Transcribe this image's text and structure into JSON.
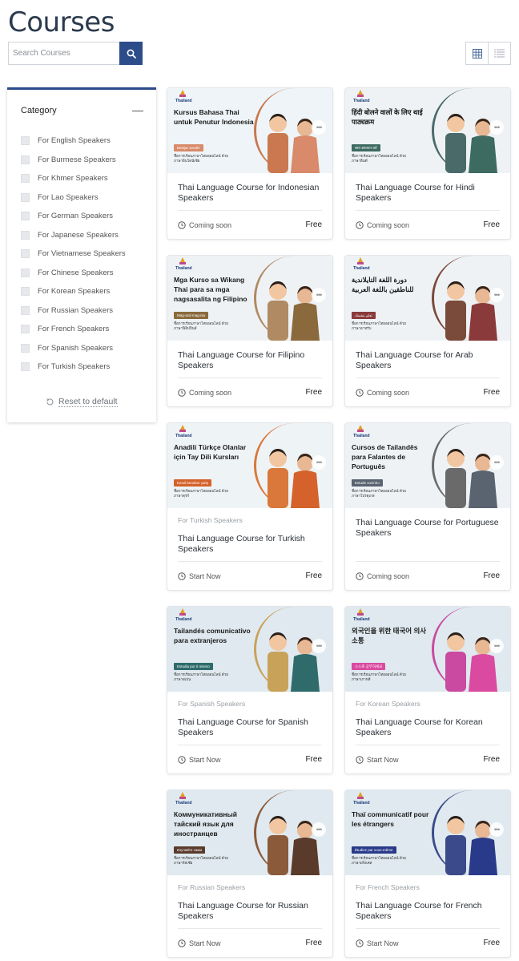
{
  "page": {
    "title": "Courses"
  },
  "search": {
    "placeholder": "Search Courses",
    "button_icon": "search-icon"
  },
  "view": {
    "grid_icon": "grid-view-icon",
    "list_icon": "list-view-icon"
  },
  "sidebar": {
    "heading": "Category",
    "items": [
      "For English Speakers",
      "For Burmese Speakers",
      "For Khmer Speakers",
      "For Lao Speakers",
      "For German Speakers",
      "For Japanese Speakers",
      "For Vietnamese Speakers",
      "For Chinese Speakers",
      "For Korean Speakers",
      "For Russian Speakers",
      "For French Speakers",
      "For Spanish Speakers",
      "For Turkish Speakers"
    ],
    "reset_label": "Reset to default"
  },
  "courses": [
    {
      "banner_title": "Kursus Bahasa Thai untuk Penutur Indonesia",
      "banner_tag": "Belajar sendiri",
      "banner_note": "ชื่อการเรียนภาษาไทยออนไลน์ ด้วยภาษาอินโดนีเซีย",
      "category": "",
      "title": "Thai Language Course for Indonesian Speakers",
      "status": "Coming soon",
      "price": "Free",
      "accent": "#c9784f",
      "tag_color": "#d98a6a",
      "bg": "#eef4f7"
    },
    {
      "banner_title": "हिंदी बोलने वालों के लिए थाई पाठ्यक्रम",
      "banner_tag": "स्वयं अध्ययन करें",
      "banner_note": "ชื่อการเรียนภาษาไทยออนไลน์ ด้วยภาษาฮินดี",
      "category": "",
      "title": "Thai Language Course for Hindi Speakers",
      "status": "Coming soon",
      "price": "Free",
      "accent": "#4a6a6a",
      "tag_color": "#3d6b62",
      "bg": "#eef2f4"
    },
    {
      "banner_title": "Mga Kurso sa Wikang Thai para sa mga nagsasalita ng Filipino",
      "banner_tag": "Mag-aral mag-isa",
      "banner_note": "ชื่อการเรียนภาษาไทยออนไลน์ ด้วยภาษาฟิลิปปินส์",
      "category": "",
      "title": "Thai Language Course for Filipino Speakers",
      "status": "Coming soon",
      "price": "Free",
      "accent": "#b08a62",
      "tag_color": "#8a6a3d",
      "bg": "#eef2f5"
    },
    {
      "banner_title": "دورة اللغة التايلاندية للناطقين باللغة العربية",
      "banner_tag": "تعلم بنفسك",
      "banner_note": "ชื่อการเรียนภาษาไทยออนไลน์ ด้วยภาษาอาหรับ",
      "category": "",
      "title": "Thai Language Course for Arab Speakers",
      "status": "Coming soon",
      "price": "Free",
      "accent": "#7a4a3a",
      "tag_color": "#8a3a3a",
      "bg": "#eef2f5"
    },
    {
      "banner_title": "Anadili Türkçe Olanlar için Tay Dili Kursları",
      "banner_tag": "Kendi kendine çalış",
      "banner_note": "ชื่อการเรียนภาษาไทยออนไลน์ ด้วยภาษาตุรกี",
      "category": "For Turkish Speakers",
      "title": "Thai Language Course for Turkish Speakers",
      "status": "Start Now",
      "price": "Free",
      "accent": "#d9783a",
      "tag_color": "#d4622a",
      "bg": "#eef3f6"
    },
    {
      "banner_title": "Cursos de Tailandês para Falantes de Português",
      "banner_tag": "Estude sozinho",
      "banner_note": "ชื่อการเรียนภาษาไทยออนไลน์ ด้วยภาษาโปรตุเกส",
      "category": "",
      "title": "Thai Language Course for Portuguese Speakers",
      "status": "Coming soon",
      "price": "Free",
      "accent": "#6a6a6a",
      "tag_color": "#5a6470",
      "bg": "#eef2f5"
    },
    {
      "banner_title": "Tailandés comunicativo para extranjeros",
      "banner_tag": "Estudia por ti mismo",
      "banner_note": "ชื่อการเรียนภาษาไทยออนไลน์ ด้วยภาษาสเปน",
      "category": "For Spanish Speakers",
      "title": "Thai Language Course for Spanish Speakers",
      "status": "Start Now",
      "price": "Free",
      "accent": "#c9a25a",
      "tag_color": "#2f6b6b",
      "bg": "#dfe9ef"
    },
    {
      "banner_title": "외국인을 위한 태국어 의사소통",
      "banner_tag": "스스로 공부하세요",
      "banner_note": "ชื่อการเรียนภาษาไทยออนไลน์ ด้วยภาษาเกาหลี",
      "category": "For Korean Speakers",
      "title": "Thai Language Course for Korean Speakers",
      "status": "Start Now",
      "price": "Free",
      "accent": "#c94aa0",
      "tag_color": "#d94aa0",
      "bg": "#dfe9ef"
    },
    {
      "banner_title": "Коммуникативный тайский язык для иностранцев",
      "banner_tag": "Изучайте сами",
      "banner_note": "ชื่อการเรียนภาษาไทยออนไลน์ ด้วยภาษารัสเซีย",
      "category": "For Russian Speakers",
      "title": "Thai Language Course for Russian Speakers",
      "status": "Start Now",
      "price": "Free",
      "accent": "#8a5a3a",
      "tag_color": "#5a3a2a",
      "bg": "#dfe9ef"
    },
    {
      "banner_title": "Thaï communicatif pour les étrangers",
      "banner_tag": "Étudiez par vous-même",
      "banner_note": "ชื่อการเรียนภาษาไทยออนไลน์ ด้วยภาษาฝรั่งเศส",
      "category": "For French Speakers",
      "title": "Thai Language Course for French Speakers",
      "status": "Start Now",
      "price": "Free",
      "accent": "#3a4a8a",
      "tag_color": "#2a3a8a",
      "bg": "#dfe9ef"
    }
  ],
  "colors": {
    "primary": "#2d4c8a",
    "text": "#2a2f36",
    "muted": "#9aa0a6"
  }
}
